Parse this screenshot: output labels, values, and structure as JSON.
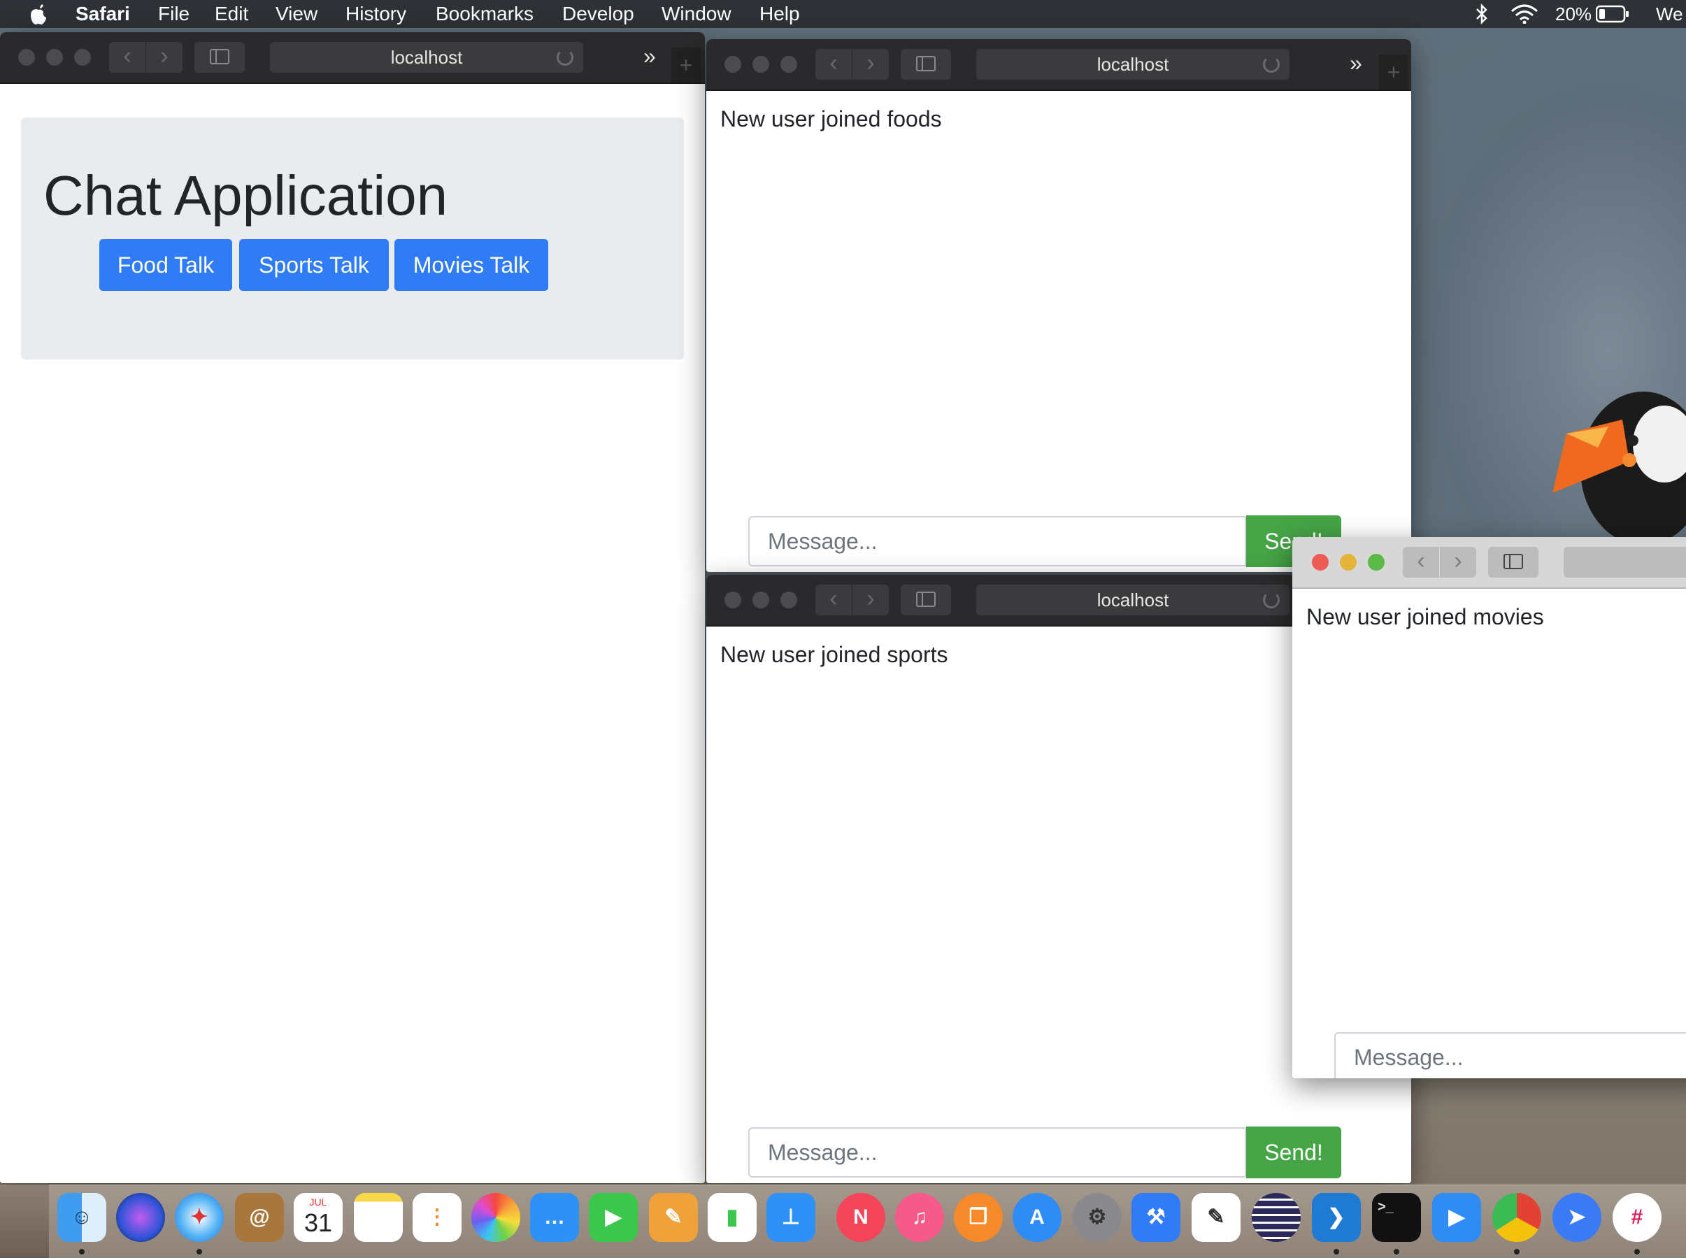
{
  "menubar": {
    "app": "Safari",
    "items": [
      "File",
      "Edit",
      "View",
      "History",
      "Bookmarks",
      "Develop",
      "Window",
      "Help"
    ],
    "battery": "20%",
    "clock_partial": "We"
  },
  "windows": {
    "home": {
      "url": "localhost",
      "title": "Chat Application",
      "rooms": [
        "Food Talk",
        "Sports Talk",
        "Movies Talk"
      ]
    },
    "foods": {
      "url": "localhost",
      "notice": "New user joined foods",
      "placeholder": "Message...",
      "send_label": "Send!"
    },
    "sports": {
      "url": "localhost",
      "notice": "New user joined sports",
      "placeholder": "Message...",
      "send_label": "Send!"
    },
    "movies": {
      "notice": "New user joined movies",
      "placeholder": "Message..."
    }
  },
  "dock": {
    "apps": [
      "Finder",
      "Siri",
      "Safari",
      "Contacts",
      "Calendar",
      "Notes",
      "Reminders",
      "Photos",
      "Messages",
      "FaceTime",
      "Pages",
      "Numbers",
      "Keynote",
      "News",
      "Music",
      "Books",
      "App Store",
      "System Preferences",
      "Xcode",
      "TextEdit",
      "Eclipse",
      "VS Code",
      "Terminal",
      "Zoom",
      "Chrome",
      "Direct Mail",
      "Slack"
    ],
    "calendar_month": "JUL",
    "calendar_day": "31"
  },
  "colors": {
    "primary": "#2f7cf6",
    "success": "#46a546",
    "jumbotron": "#e9ecef"
  }
}
